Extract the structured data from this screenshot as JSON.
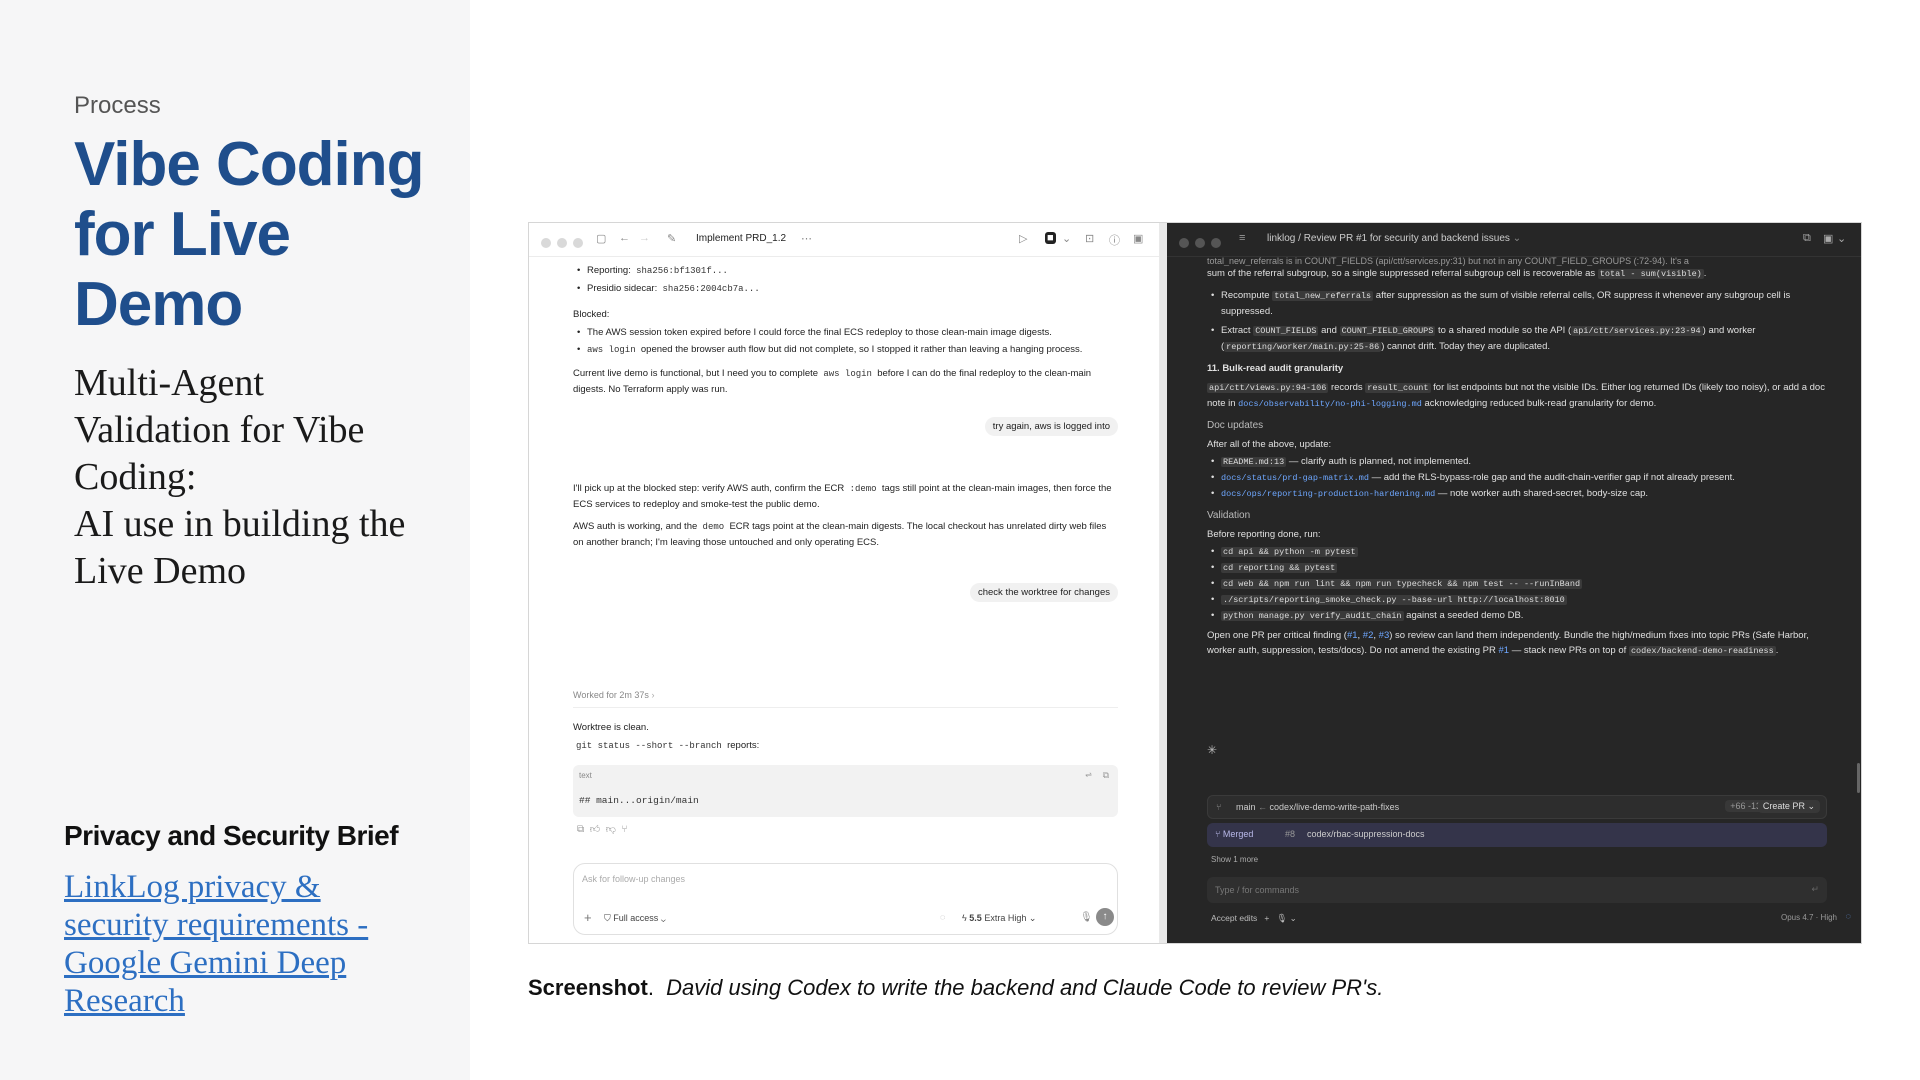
{
  "slide": {
    "kicker": "Process",
    "title": "Vibe Coding for Live Demo",
    "subtitle_lines": [
      "Multi-Agent",
      "Validation for Vibe",
      "Coding:",
      "AI use in building the",
      "Live Demo"
    ],
    "brief_title": "Privacy and Security Brief",
    "brief_link": "LinkLog privacy & security requirements - Google Gemini Deep Research"
  },
  "codex": {
    "tab_title": "Implement PRD_1.2",
    "reporting_label": "Reporting:",
    "reporting_value": "sha256:bf1301f...",
    "presidio_label": "Presidio sidecar:",
    "presidio_value": "sha256:2004cb7a...",
    "blocked_heading": "Blocked:",
    "blocked_1": "The AWS session token expired before I could force the final ECS redeploy to those clean-main image digests.",
    "blocked_2_code": "aws login",
    "blocked_2": "opened the browser auth flow but did not complete, so I stopped it rather than leaving a hanging process.",
    "status_pre": "Current live demo is functional, but I need you to complete",
    "status_code": "aws login",
    "status_post": "before I can do the final redeploy to the clean-main digests. No Terraform apply was run.",
    "user_msg_1": "try again, aws is logged into",
    "reply_1_pre": "I'll pick up at the blocked step: verify AWS auth, confirm the ECR",
    "reply_1_code": ":demo",
    "reply_1_post": "tags still point at the clean-main images, then force the ECS services to redeploy and smoke-test the public demo.",
    "reply_2_pre": "AWS auth is working, and the",
    "reply_2_code": "demo",
    "reply_2_post": "ECR tags point at the clean-main digests. The local checkout has unrelated dirty web files on another branch; I'm leaving those untouched and only operating ECS.",
    "user_msg_2": "check the worktree for changes",
    "worked_for": "Worked for 2m 37s",
    "worktree_clean": "Worktree is clean.",
    "git_cmd": "git status --short --branch",
    "git_reports": "reports:",
    "code_lang": "text",
    "code_output": "## main...origin/main",
    "composer_placeholder": "Ask for follow-up changes",
    "access": "Full access",
    "model": "5.5",
    "effort": "Extra High"
  },
  "claude": {
    "title_repo": "linklog",
    "title_task": "Review PR #1 for security and backend issues",
    "lines": {
      "top_partial": "total_new_referrals is in COUNT_FIELDS (api/ctt/services.py:31) but not in any COUNT_FIELD_GROUPS (:72-94). It's a",
      "top_2_pre": "sum of the referral subgroup, so a single suppressed referral subgroup cell is recoverable as",
      "top_2_code": "total - sum(visible)",
      "b1_pre": "Recompute",
      "b1_code": "total_new_referrals",
      "b1_post": "after suppression as the sum of visible referral cells, OR suppress it whenever any subgroup cell is suppressed.",
      "b2_pre": "Extract",
      "b2_code1": "COUNT_FIELDS",
      "b2_and": "and",
      "b2_code2": "COUNT_FIELD_GROUPS",
      "b2_mid": "to a shared module so the API (",
      "b2_code3": "api/ctt/services.py:23-94",
      "b2_mid2": ") and worker (",
      "b2_code4": "reporting/worker/main.py:25-86",
      "b2_post": ") cannot drift. Today they are duplicated.",
      "h11": "11. Bulk-read audit granularity",
      "p11_code1": "api/ctt/views.py:94-106",
      "p11_records": "records",
      "p11_code2": "result_count",
      "p11_mid": "for list endpoints but not the visible IDs. Either log returned IDs (likely too noisy), or add a doc note in",
      "p11_link": "docs/observability/no-phi-logging.md",
      "p11_post": "acknowledging reduced bulk-read granularity for demo.",
      "doc_updates": "Doc updates",
      "after_all": "After all of the above, update:",
      "d1_code": "README.md:13",
      "d1": "— clarify auth is planned, not implemented.",
      "d2_link": "docs/status/prd-gap-matrix.md",
      "d2": "— add the RLS-bypass-role gap and the audit-chain-verifier gap if not already present.",
      "d3_link": "docs/ops/reporting-production-hardening.md",
      "d3": "— note worker auth shared-secret, body-size cap.",
      "validation": "Validation",
      "before_done": "Before reporting done, run:",
      "v1": "cd api && python -m pytest",
      "v2": "cd reporting && pytest",
      "v3": "cd web && npm run lint && npm run typecheck && npm test -- --runInBand",
      "v4": "./scripts/reporting_smoke_check.py --base-url http://localhost:8010",
      "v5_code": "python manage.py verify_audit_chain",
      "v5": "against a seeded demo DB.",
      "open_pre": "Open one PR per critical finding (",
      "open_f1": "#1",
      "open_f2": "#2",
      "open_f3": "#3",
      "open_mid": ") so review can land them independently. Bundle the high/medium fixes into topic PRs (Safe Harbor, worker auth, suppression, tests/docs). Do not amend the existing PR",
      "open_pr": "#1",
      "open_post": "— stack new PRs on top of",
      "open_code": "codex/backend-demo-readiness",
      "open_end": "."
    },
    "branch_main": "main",
    "branch_arrow": "←",
    "branch_name": "codex/live-demo-write-path-fixes",
    "diffstat": "+66 -13",
    "create_pr": "Create PR",
    "merged_label": "Merged",
    "merged_num": "#8",
    "merged_branch": "codex/rbac-suppression-docs",
    "show_more": "Show 1 more",
    "input_placeholder": "Type / for commands",
    "accept_edits": "Accept edits",
    "model": "Opus 4.7 · High"
  },
  "caption": {
    "bold": "Screenshot",
    "rest": "David using Codex to write the backend and Claude Code to review PR's."
  }
}
